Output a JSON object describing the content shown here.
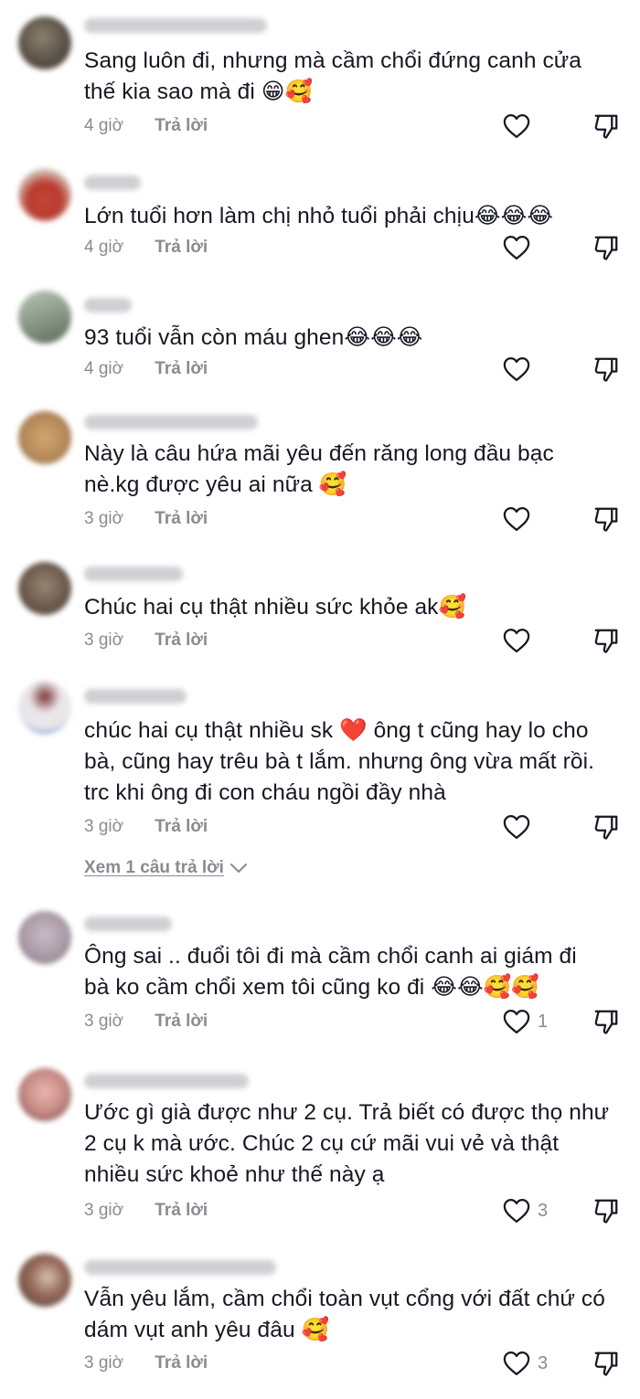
{
  "comments": [
    {
      "text": "Sang luôn đi, nhưng mà cầm chổi đứng canh cửa\nthế kia sao mà đi 😁🥰",
      "time": "4 giờ",
      "reply_label": "Trả lời",
      "likes": "",
      "avatar_color": "#5b5247"
    },
    {
      "text": "Lớn tuổi hơn làm chị nhỏ tuổi phải chịu😂😂😂",
      "time": "4 giờ",
      "reply_label": "Trả lời",
      "likes": "",
      "avatar_color": "#b83a2e"
    },
    {
      "text": "93 tuổi vẫn còn máu ghen😂😂😂",
      "time": "4 giờ",
      "reply_label": "Trả lời",
      "likes": "",
      "avatar_color": "#8c9a8a"
    },
    {
      "text": "Này là câu hứa mãi yêu đến răng long đầu bạc\nnè.kg được yêu ai nữa 🥰",
      "time": "3 giờ",
      "reply_label": "Trả lời",
      "likes": "",
      "avatar_color": "#b58a5a"
    },
    {
      "text": "Chúc hai cụ thật nhiều sức khỏe ak🥰",
      "time": "3 giờ",
      "reply_label": "Trả lời",
      "likes": "",
      "avatar_color": "#6b5a4c"
    },
    {
      "text": "chúc hai cụ thật nhiều sk ❤️ ông t cũng hay lo cho\nbà, cũng hay trêu bà t lắm. nhưng ông vừa mất rồi.\ntrc khi ông đi con cháu ngồi đầy nhà",
      "time": "3 giờ",
      "reply_label": "Trả lời",
      "likes": "",
      "avatar_color": "#e9e6ea",
      "view_replies": "Xem 1 câu trả lời"
    },
    {
      "text": "Ông sai .. đuổi tôi đi mà cầm chổi canh ai giám đi\nbà ko cầm chổi xem tôi cũng ko đi 😂😂🥰🥰",
      "time": "3 giờ",
      "reply_label": "Trả lời",
      "likes": "1",
      "avatar_color": "#a99aa6"
    },
    {
      "text": "Ước gì già được như 2 cụ. Trả biết có được thọ như\n2 cụ k mà ước. Chúc 2 cụ cứ mãi vui vẻ và thật\nnhiều sức khoẻ như thế này ạ",
      "time": "3 giờ",
      "reply_label": "Trả lời",
      "likes": "3",
      "avatar_color": "#c98b86"
    },
    {
      "text": "Vẫn yêu lắm, cầm chổi toàn vụt cổng với đất chứ có\ndám vụt anh yêu đâu 🥰",
      "time": "3 giờ",
      "reply_label": "Trả lời",
      "likes": "3",
      "avatar_color": "#6e4e44"
    }
  ]
}
